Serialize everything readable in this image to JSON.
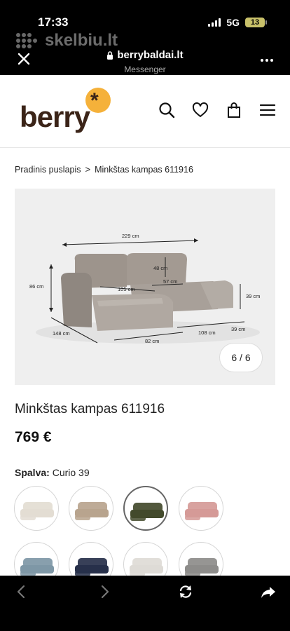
{
  "status_bar": {
    "time": "17:33",
    "network": "5G",
    "battery": "13"
  },
  "watermark": {
    "text": "skelbiu.lt"
  },
  "browser": {
    "url": "berrybaldai.lt",
    "subtitle": "Messenger",
    "icons": [
      "close-icon",
      "lock-icon",
      "more-icon",
      "back-icon",
      "forward-icon",
      "reload-icon",
      "share-icon"
    ]
  },
  "header": {
    "logo_text": "berry",
    "logo_mark": "*",
    "icons": [
      "search-icon",
      "heart-icon",
      "bag-icon",
      "menu-icon"
    ],
    "colors": {
      "brand_brown": "#3b2418",
      "brand_orange": "#f5b13a"
    }
  },
  "breadcrumb": {
    "home": "Pradinis puslapis",
    "separator": ">",
    "current": "Minkštas kampas 611916"
  },
  "gallery": {
    "counter": "6 / 6",
    "dimensions": {
      "top_width": "229 cm",
      "height": "86 cm",
      "back_height": "48 cm",
      "chaise_depth": "105 cm",
      "seat_depth": "57 cm",
      "side_height": "39 cm",
      "chaise_length": "148 cm",
      "front_width": "82 cm",
      "section_width": "108 cm",
      "end_width": "39 cm"
    }
  },
  "product": {
    "title": "Minkštas kampas 611916",
    "price": "769 €",
    "color_label": "Spalva:",
    "color_value": "Curio 39",
    "swatches": [
      {
        "color": "#e3ddd3",
        "selected": false
      },
      {
        "color": "#b8a48e",
        "selected": false
      },
      {
        "color": "#434a2c",
        "selected": true
      },
      {
        "color": "#d59a97",
        "selected": false
      },
      {
        "color": "#7e97a6",
        "selected": false
      },
      {
        "color": "#27304a",
        "selected": false
      },
      {
        "color": "#dedbd6",
        "selected": false
      },
      {
        "color": "#8d8c8a",
        "selected": false
      }
    ]
  }
}
